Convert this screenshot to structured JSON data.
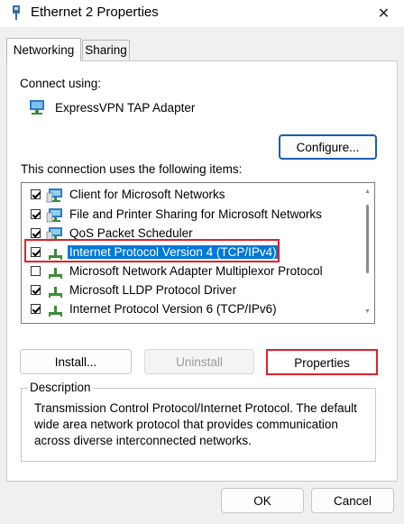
{
  "window": {
    "title": "Ethernet 2 Properties",
    "close_glyph": "✕"
  },
  "tabs": [
    {
      "label": "Networking",
      "active": true
    },
    {
      "label": "Sharing",
      "active": false
    }
  ],
  "connect_using": {
    "label": "Connect using:",
    "adapter": "ExpressVPN TAP Adapter",
    "adapter_icon": "network-adapter-icon",
    "configure_button": "Configure..."
  },
  "items_label": "This connection uses the following items:",
  "items": [
    {
      "label": "Client for Microsoft Networks",
      "checked": true,
      "icon": "network-client-icon",
      "selected": false
    },
    {
      "label": "File and Printer Sharing for Microsoft Networks",
      "checked": true,
      "icon": "network-client-icon",
      "selected": false
    },
    {
      "label": "QoS Packet Scheduler",
      "checked": true,
      "icon": "network-client-icon",
      "selected": false
    },
    {
      "label": "Internet Protocol Version 4 (TCP/IPv4)",
      "checked": true,
      "icon": "protocol-icon",
      "selected": true
    },
    {
      "label": "Microsoft Network Adapter Multiplexor Protocol",
      "checked": false,
      "icon": "protocol-icon",
      "selected": false
    },
    {
      "label": "Microsoft LLDP Protocol Driver",
      "checked": true,
      "icon": "protocol-icon",
      "selected": false
    },
    {
      "label": "Internet Protocol Version 6 (TCP/IPv6)",
      "checked": true,
      "icon": "protocol-icon",
      "selected": false
    }
  ],
  "buttons": {
    "install": "Install...",
    "uninstall": "Uninstall",
    "properties": "Properties",
    "ok": "OK",
    "cancel": "Cancel"
  },
  "description": {
    "title": "Description",
    "text": "Transmission Control Protocol/Internet Protocol. The default wide area network protocol that provides communication across diverse interconnected networks."
  },
  "colors": {
    "selection": "#0078d7",
    "highlight_box": "#d9242b",
    "focus_border": "#1a5fb4"
  }
}
